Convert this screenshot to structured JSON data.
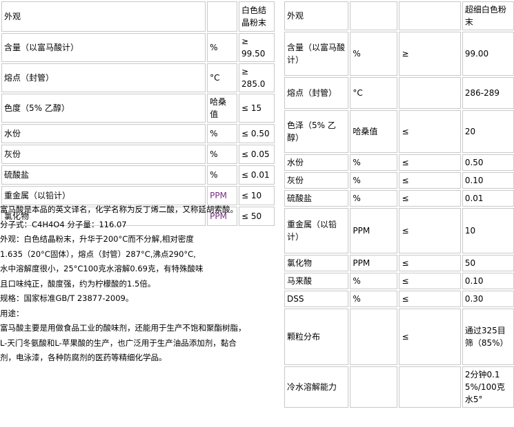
{
  "left_table": {
    "rows": [
      {
        "item": "外观",
        "unit": "",
        "value": "白色结晶粉末"
      },
      {
        "item": "含量（以富马酸计）",
        "unit": "%",
        "value": "≥ 99.50"
      },
      {
        "item": "熔点（封管）",
        "unit": "°C",
        "value": "≥ 285.0"
      },
      {
        "item": "色度（5% 乙醇）",
        "unit": "哈桑值",
        "value": "≤ 15"
      },
      {
        "item": "水份",
        "unit": "%",
        "value": "≤ 0.50"
      },
      {
        "item": "灰份",
        "unit": "%",
        "value": "≤ 0.05"
      },
      {
        "item": "硫酸盐",
        "unit": "%",
        "value": "≤ 0.01"
      },
      {
        "item": "重金属（以铅计）",
        "unit": "PPM",
        "value": "≤ 10"
      },
      {
        "item": "氯化物",
        "unit": "PPM",
        "value": "≤ 50"
      }
    ]
  },
  "description": {
    "lines": [
      "富马酸是本品的英文译名，化学名称为反丁烯二酸，又称延胡索酸。",
      "分子式：C4H4O4 分子量：116.07",
      "外观：白色结晶粉末，升华于200°C而不分解,相对密度",
      "1.635（20°C固体），熔点（封管）287°C,沸点290°C,",
      "水中溶解度很小，25°C100克水溶解0.69克，有特殊酸味",
      "且口味纯正，酸度强，约为柠檬酸的1.5倍。",
      "规格：国家标准GB/T 23877-2009。",
      "用途：",
      "富马酸主要是用做食品工业的酸味剂，还能用于生产不饱和聚酯树脂，",
      "L-天门冬氨酸和L-苹果酸的生产，也广泛用于生产油品添加剂，黏合",
      "剂，电泳漆，各种防腐剂的医药等精细化学品。"
    ]
  },
  "right_table": {
    "rows": [
      {
        "item": "外观",
        "unit": "",
        "op": "",
        "value": "超细白色粉末"
      },
      {
        "item": "含量（以富马酸计）",
        "unit": "%",
        "op": "≥",
        "value": "99.00"
      },
      {
        "item": "熔点（封管）",
        "unit": "°C",
        "op": "",
        "value": "286-289"
      },
      {
        "item": "色泽（5% 乙醇）",
        "unit": "哈桑值",
        "op": "≤",
        "value": "20"
      },
      {
        "item": "水份",
        "unit": "%",
        "op": "≤",
        "value": "0.50"
      },
      {
        "item": "灰份",
        "unit": "%",
        "op": "≤",
        "value": "0.10"
      },
      {
        "item": "硫酸盐",
        "unit": "%",
        "op": "≤",
        "value": "0.01"
      },
      {
        "item": "重金属（以铅计）",
        "unit": "PPM",
        "op": "≤",
        "value": "10"
      },
      {
        "item": "氯化物",
        "unit": "PPM",
        "op": "≤",
        "value": "50"
      },
      {
        "item": "马来酸",
        "unit": "%",
        "op": "≤",
        "value": "0.10"
      },
      {
        "item": "DSS",
        "unit": "%",
        "op": "≤",
        "value": "0.30"
      },
      {
        "item": "颗粒分布",
        "unit": "",
        "op": "≤",
        "value": "通过325目筛（85%）"
      },
      {
        "item": "冷水溶解能力",
        "unit": "",
        "op": "",
        "value": "2分钟0.15%/100克水5°"
      }
    ]
  }
}
